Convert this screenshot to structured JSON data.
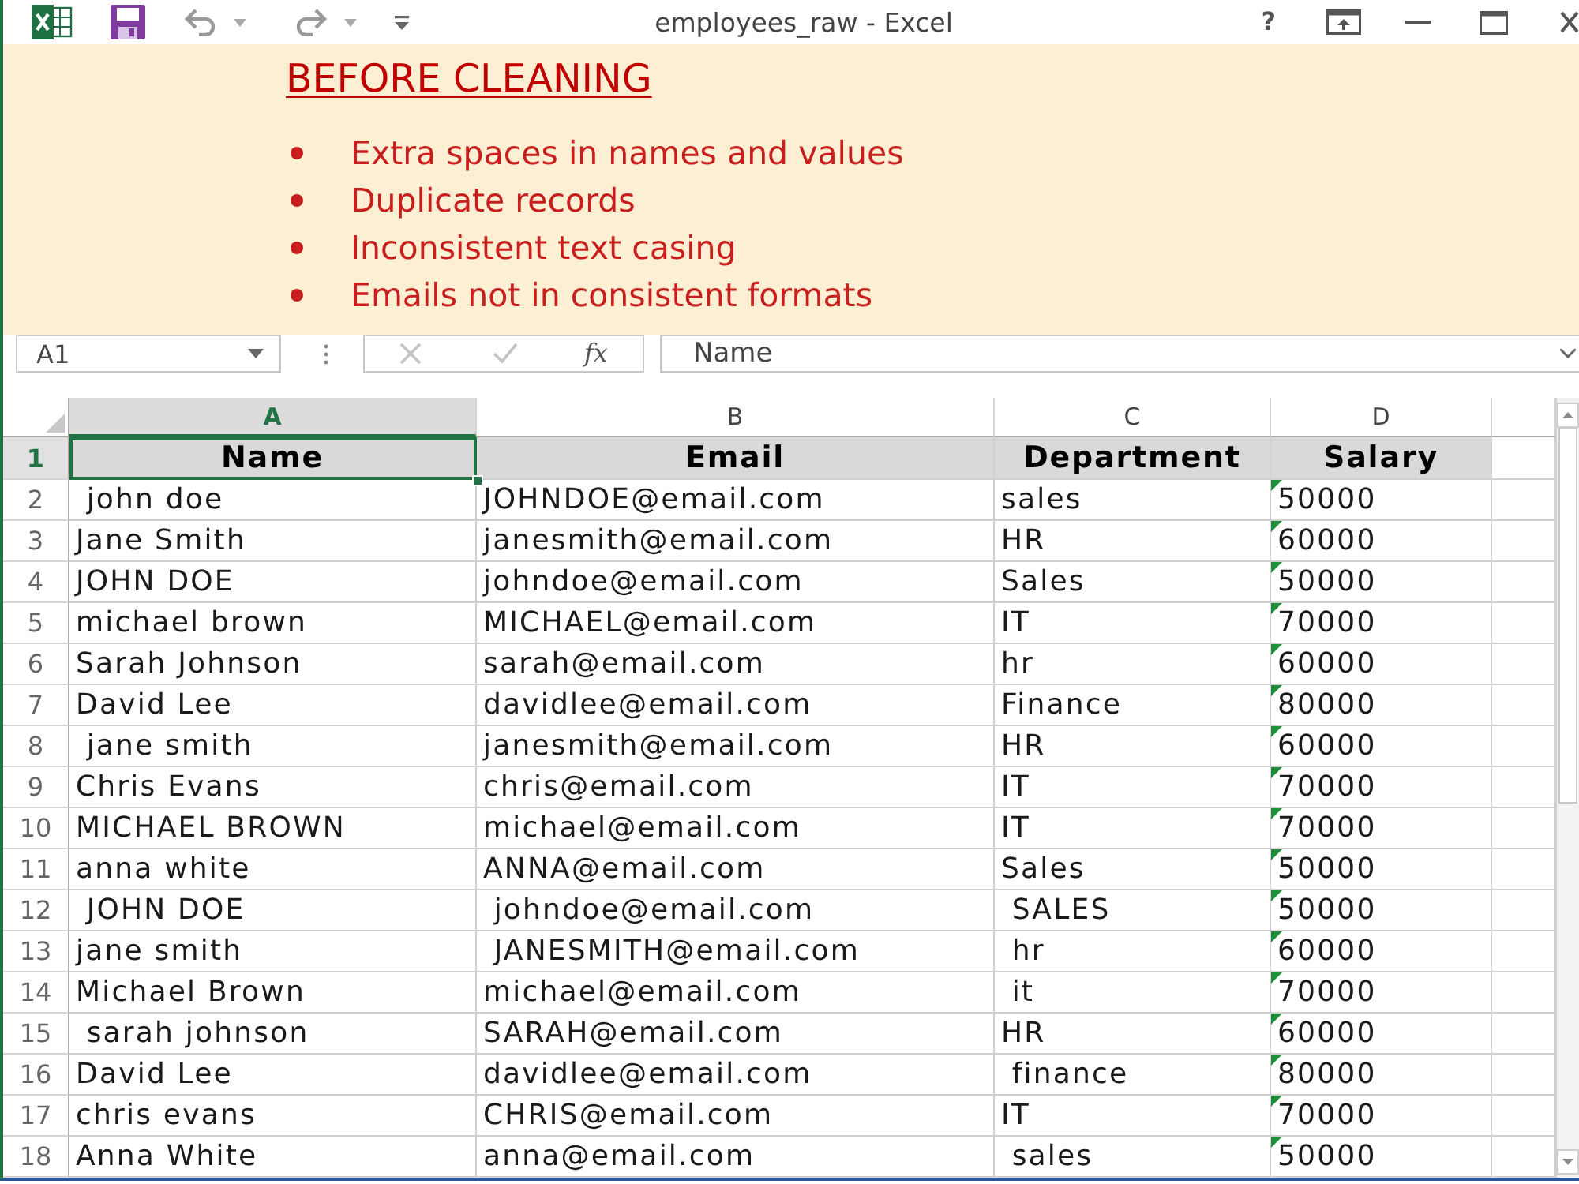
{
  "window": {
    "title": "employees_raw - Excel",
    "help": "?"
  },
  "note": {
    "title": "BEFORE CLEANING",
    "items": [
      "Extra spaces in names and values",
      "Duplicate records",
      "Inconsistent text casing",
      "Emails not in consistent formats"
    ]
  },
  "formula_bar": {
    "name_box": "A1",
    "cancel": {
      "disabled": true
    },
    "enter": {
      "disabled": true
    },
    "function_label": "fx",
    "formula": "Name"
  },
  "sheet": {
    "columns": [
      {
        "label": "A",
        "selected": true
      },
      {
        "label": "B",
        "selected": false
      },
      {
        "label": "C",
        "selected": false
      },
      {
        "label": "D",
        "selected": false
      }
    ],
    "rows": [
      {
        "number": "1",
        "kind": "header",
        "selected": true,
        "flagged": false,
        "cells": [
          "Name",
          "Email",
          "Department",
          "Salary"
        ]
      },
      {
        "number": "2",
        "kind": "data",
        "selected": false,
        "flagged": true,
        "cells": [
          " john doe",
          "JOHNDOE@email.com",
          "sales",
          "50000"
        ]
      },
      {
        "number": "3",
        "kind": "data",
        "selected": false,
        "flagged": true,
        "cells": [
          "Jane Smith",
          "janesmith@email.com",
          "HR",
          "60000"
        ]
      },
      {
        "number": "4",
        "kind": "data",
        "selected": false,
        "flagged": true,
        "cells": [
          "JOHN DOE",
          "johndoe@email.com",
          "Sales",
          "50000"
        ]
      },
      {
        "number": "5",
        "kind": "data",
        "selected": false,
        "flagged": true,
        "cells": [
          "michael brown",
          "MICHAEL@email.com",
          "IT",
          "70000"
        ]
      },
      {
        "number": "6",
        "kind": "data",
        "selected": false,
        "flagged": true,
        "cells": [
          "Sarah Johnson",
          "sarah@email.com",
          "hr",
          "60000"
        ]
      },
      {
        "number": "7",
        "kind": "data",
        "selected": false,
        "flagged": true,
        "cells": [
          "David Lee",
          "davidlee@email.com",
          "Finance",
          "80000"
        ]
      },
      {
        "number": "8",
        "kind": "data",
        "selected": false,
        "flagged": true,
        "cells": [
          " jane smith",
          "janesmith@email.com",
          "HR",
          "60000"
        ]
      },
      {
        "number": "9",
        "kind": "data",
        "selected": false,
        "flagged": true,
        "cells": [
          "Chris Evans",
          "chris@email.com",
          "IT",
          "70000"
        ]
      },
      {
        "number": "10",
        "kind": "data",
        "selected": false,
        "flagged": true,
        "cells": [
          "MICHAEL BROWN",
          "michael@email.com",
          "IT",
          "70000"
        ]
      },
      {
        "number": "11",
        "kind": "data",
        "selected": false,
        "flagged": true,
        "cells": [
          "anna white",
          "ANNA@email.com",
          "Sales",
          "50000"
        ]
      },
      {
        "number": "12",
        "kind": "data",
        "selected": false,
        "flagged": true,
        "cells": [
          " JOHN DOE",
          " johndoe@email.com",
          " SALES",
          "50000"
        ]
      },
      {
        "number": "13",
        "kind": "data",
        "selected": false,
        "flagged": true,
        "cells": [
          "jane smith",
          " JANESMITH@email.com",
          " hr",
          "60000"
        ]
      },
      {
        "number": "14",
        "kind": "data",
        "selected": false,
        "flagged": true,
        "cells": [
          "Michael Brown",
          "michael@email.com",
          " it",
          "70000"
        ]
      },
      {
        "number": "15",
        "kind": "data",
        "selected": false,
        "flagged": true,
        "cells": [
          " sarah johnson",
          "SARAH@email.com",
          "HR",
          "60000"
        ]
      },
      {
        "number": "16",
        "kind": "data",
        "selected": false,
        "flagged": true,
        "cells": [
          "David Lee",
          "davidlee@email.com",
          " finance",
          "80000"
        ]
      },
      {
        "number": "17",
        "kind": "data",
        "selected": false,
        "flagged": true,
        "cells": [
          "chris evans",
          "CHRIS@email.com",
          "IT",
          "70000"
        ]
      },
      {
        "number": "18",
        "kind": "data",
        "selected": false,
        "flagged": true,
        "cells": [
          "Anna White",
          "anna@email.com",
          " sales",
          "50000"
        ]
      }
    ]
  }
}
